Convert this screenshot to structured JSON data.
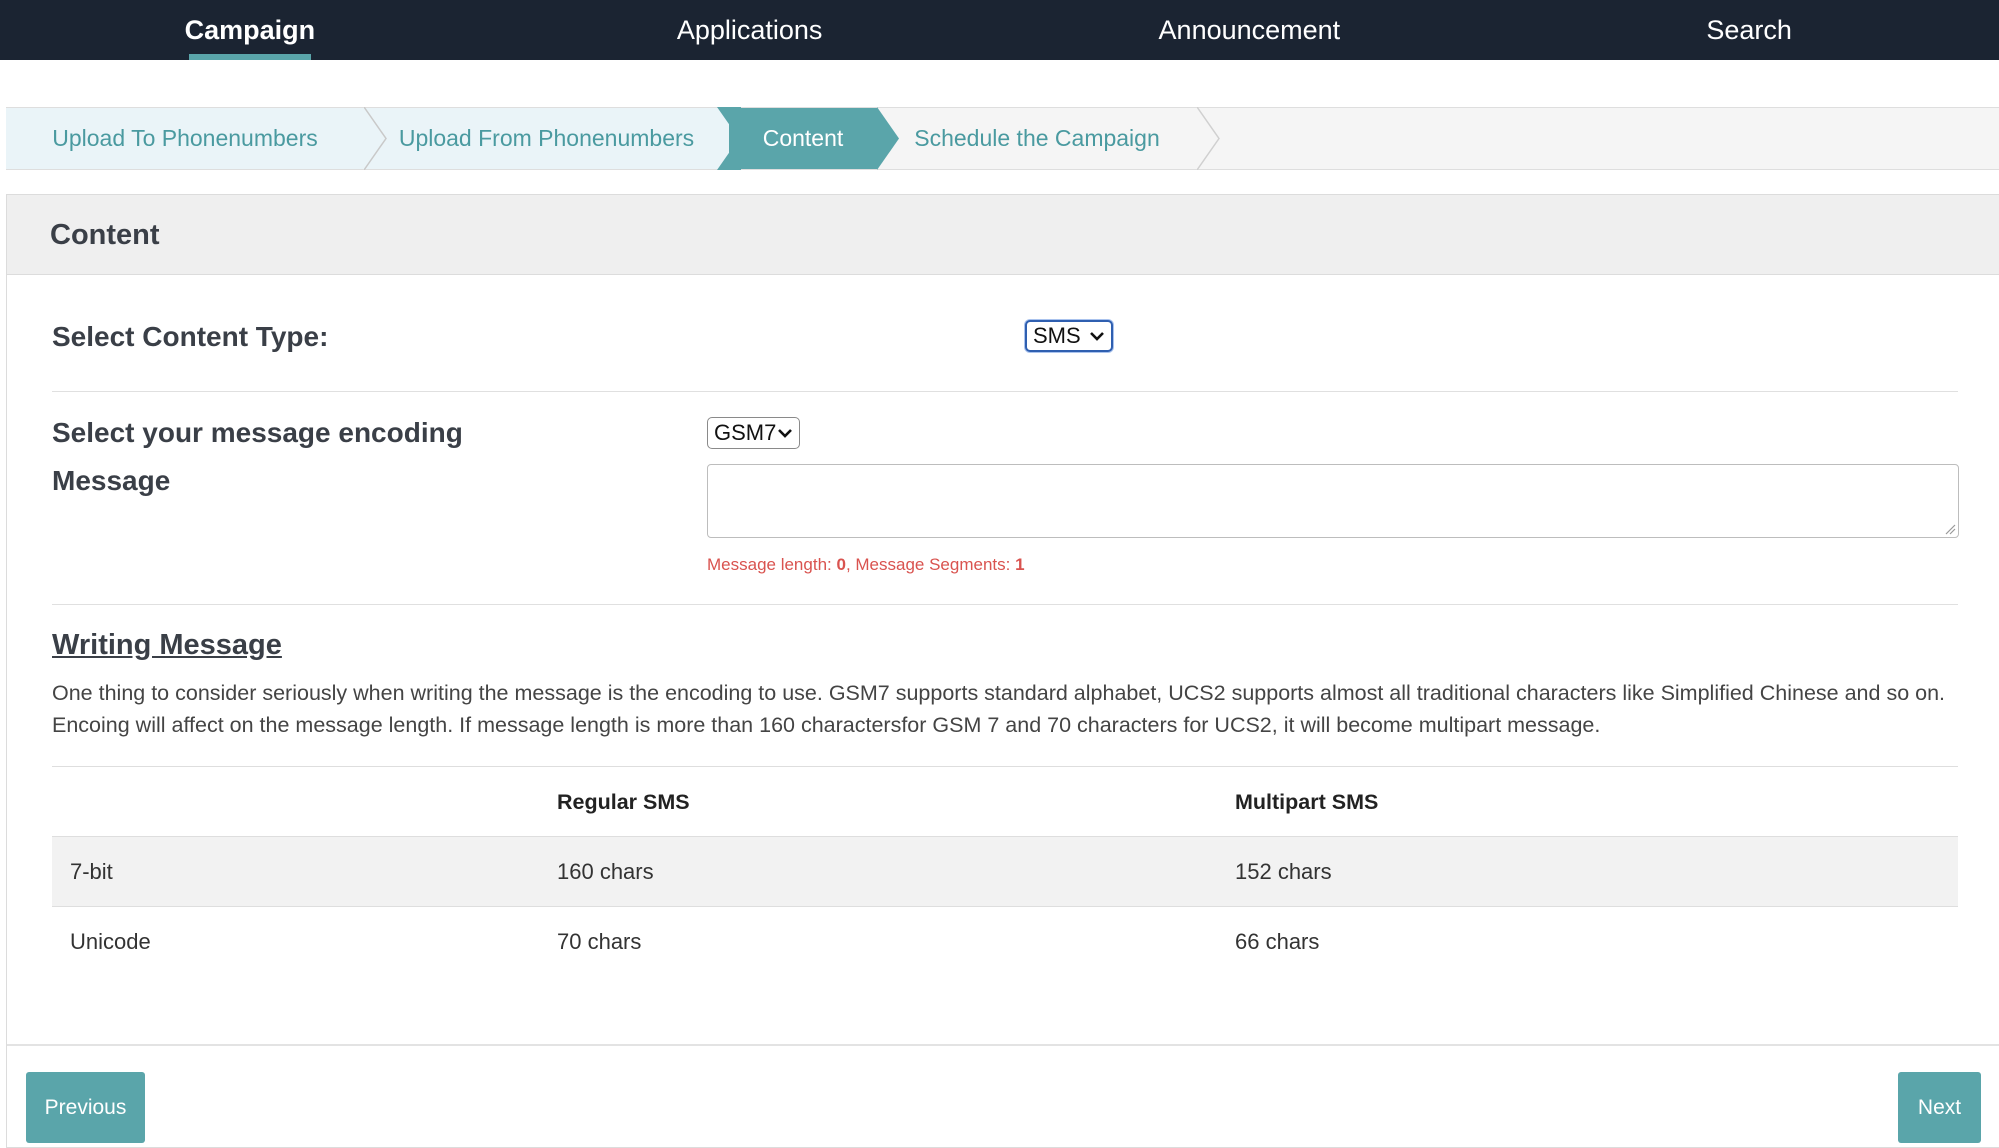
{
  "nav": {
    "items": [
      {
        "label": "Campaign",
        "active": true
      },
      {
        "label": "Applications",
        "active": false
      },
      {
        "label": "Announcement",
        "active": false
      },
      {
        "label": "Search",
        "active": false
      }
    ]
  },
  "steps": [
    {
      "label": "Upload To Phonenumbers",
      "state": "done"
    },
    {
      "label": "Upload From Phonenumbers",
      "state": "done"
    },
    {
      "label": "Content",
      "state": "active"
    },
    {
      "label": "Schedule the Campaign",
      "state": "pending"
    }
  ],
  "card": {
    "title": "Content",
    "content_type": {
      "label": "Select Content Type:",
      "value": "SMS"
    },
    "encoding": {
      "label": "Select your message encoding",
      "value": "GSM7"
    },
    "message": {
      "label": "Message",
      "value": ""
    },
    "counter": {
      "length_label": "Message length: ",
      "length_value": "0",
      "segments_label": ", Message Segments: ",
      "segments_value": "1"
    },
    "writing": {
      "title": "Writing Message",
      "text": "One thing to consider seriously when writing the message is the encoding to use. GSM7 supports standard alphabet, UCS2 supports almost all traditional characters like Simplified Chinese and so on. Encoing will affect on the message length. If message length is more than 160 charactersfor GSM 7 and 70 characters for UCS2, it will become multipart message."
    },
    "table": {
      "headers": [
        "",
        "Regular SMS",
        "Multipart SMS"
      ],
      "rows": [
        [
          "7-bit",
          "160 chars",
          "152 chars"
        ],
        [
          "Unicode",
          "70 chars",
          "66 chars"
        ]
      ]
    }
  },
  "buttons": {
    "previous": "Previous",
    "next": "Next"
  },
  "colors": {
    "nav_bg": "#1b2432",
    "accent": "#5aa5aa",
    "step_text": "#4a9aa0",
    "counter_text": "#d9534f"
  }
}
